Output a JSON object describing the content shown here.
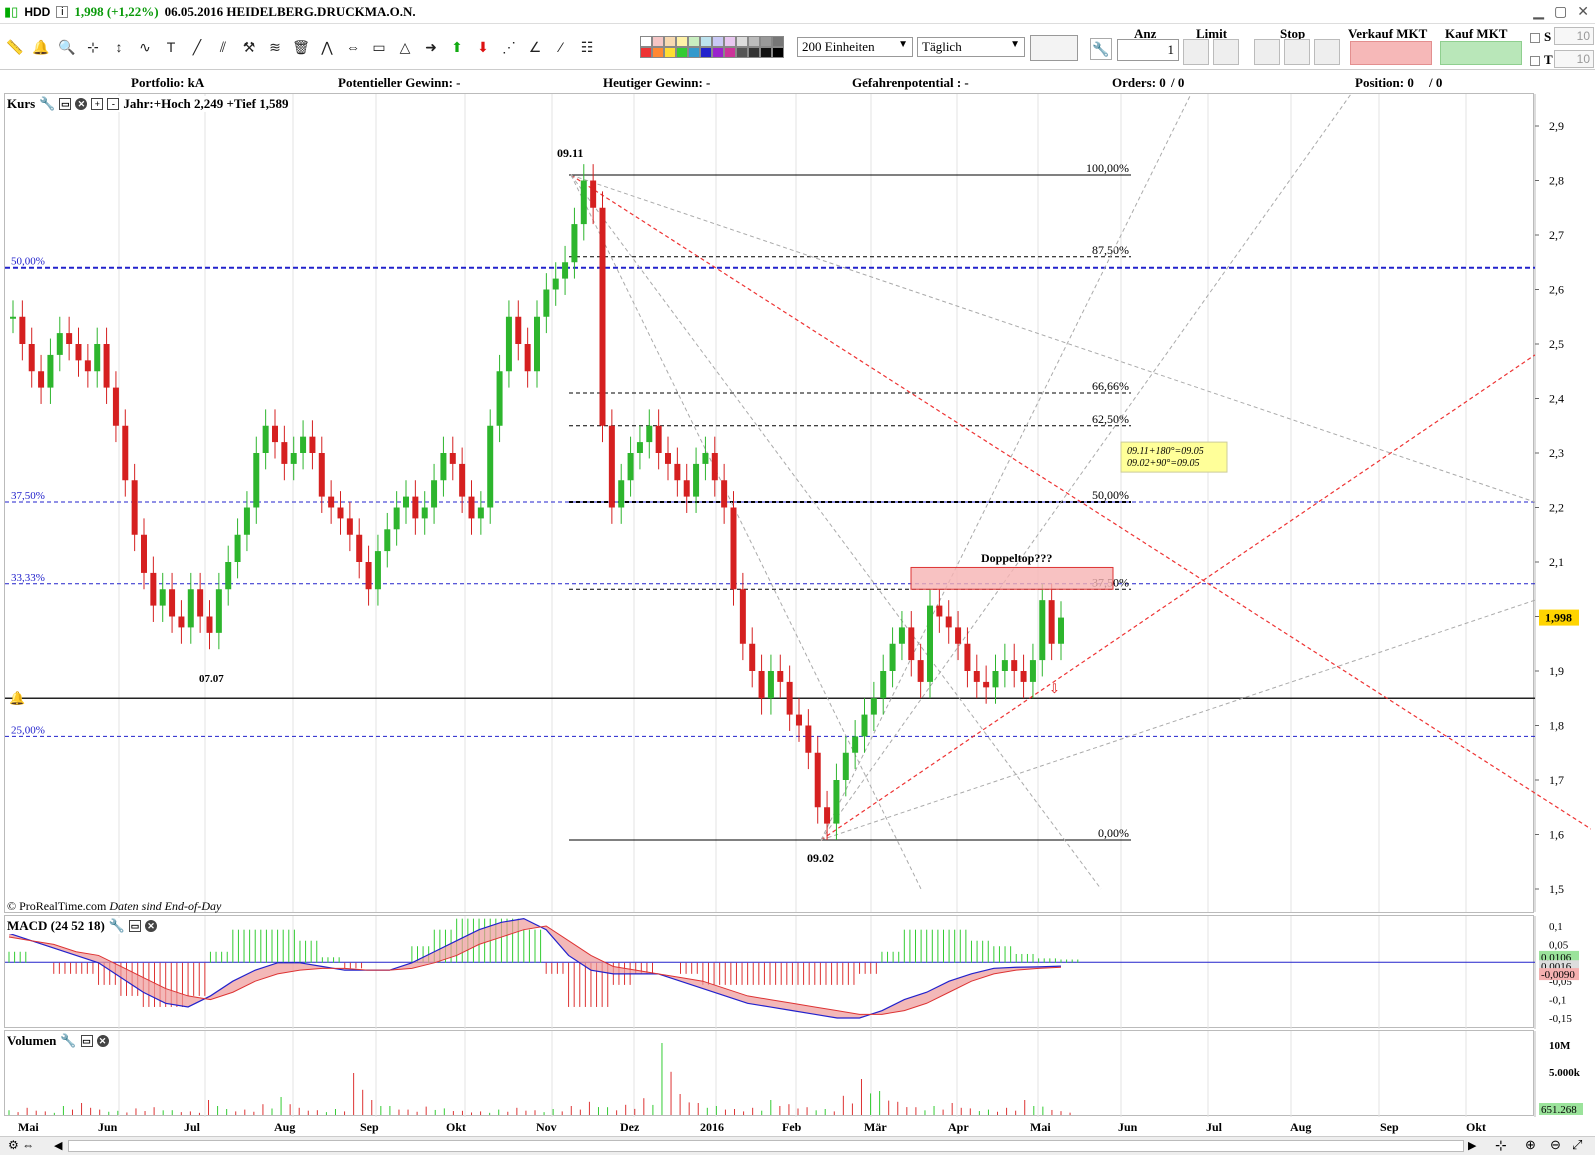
{
  "window": {
    "symbol": "HDD",
    "price_change": "1,998 (+1,22%)",
    "date_name": "06.05.2016 HEIDELBERG.DRUCKMA.O.N."
  },
  "toolbar": {
    "units_select": "200 Einheiten",
    "interval_select": "Täglich",
    "anz_label": "Anz",
    "anz_value": "1",
    "limit_label": "Limit",
    "stop_label": "Stop",
    "sell_label": "Verkauf MKT",
    "buy_label": "Kauf MKT",
    "s_label": "S",
    "s_value": "10",
    "t_label": "T",
    "t_value": "10",
    "icons": [
      "ruler-icon",
      "bell-icon",
      "zoom-icon",
      "crosshair-icon",
      "cursor-icon",
      "indicator-icon",
      "text-icon",
      "line-icon",
      "parallel-icon",
      "hammer-icon",
      "fibonacci-icon",
      "trash-icon",
      "trend-icon",
      "arrows-icon",
      "rectangle-icon",
      "triangle-icon",
      "arrow-right-icon",
      "arrow-up-icon",
      "arrow-down-icon",
      "gann-fan-icon",
      "gann-angle-icon",
      "line-tool-icon",
      "properties-icon"
    ]
  },
  "infobar": {
    "portfolio": "Portfolio: kA",
    "potential_gain": "Potentieller Gewinn: -",
    "today_gain": "Heutiger Gewinn: -",
    "risk": "Gefahrenpotential : -",
    "orders": "Orders: 0",
    "orders_sep": "/ 0",
    "position": "Position: 0",
    "position_sep": "/ 0"
  },
  "price_pane": {
    "title": "Kurs",
    "subtitle": "Jahr:+Hoch 2,249 +Tief 1,589",
    "current_price": "1,998",
    "copyright": "© ProRealTime.com",
    "eod_note": "Daten sind End-of-Day",
    "annotations": {
      "high_label": "09.11",
      "low_label": "09.02",
      "jul_label": "07.07",
      "doppeltop": "Doppeltop???",
      "note_line1": "09.11+180°=09.05",
      "note_line2": "09.02+90°=09.05"
    },
    "fib_labels": [
      "100,00%",
      "87,50%",
      "66,66%",
      "62,50%",
      "50,00%",
      "37,50%",
      "0,00%"
    ],
    "level_labels": [
      "50,00%",
      "37,50%",
      "33,33%",
      "25,00%"
    ]
  },
  "macd_pane": {
    "title": "MACD (24 52 18)",
    "value1": "0,0106",
    "value2": "0,0016",
    "value3": "-0,0090"
  },
  "volume_pane": {
    "title": "Volumen",
    "last_value": "651.268"
  },
  "chart_data": [
    {
      "type": "candlestick",
      "title": "Kurs",
      "y_ticks": [
        "2,9",
        "2,8",
        "2,7",
        "2,6",
        "2,5",
        "2,4",
        "2,3",
        "2,2",
        "2,1",
        "2",
        "1,9",
        "1,8",
        "1,7",
        "1,6",
        "1,5"
      ],
      "x_ticks": [
        "Mai",
        "Jun",
        "Jul",
        "Aug",
        "Sep",
        "Okt",
        "Nov",
        "Dez",
        "2016",
        "Feb",
        "Mär",
        "Apr",
        "Mai",
        "Jun",
        "Jul",
        "Aug",
        "Sep",
        "Okt"
      ],
      "ylim": [
        1.5,
        2.9
      ],
      "series": [
        {
          "values": [
            2.55,
            2.5,
            2.45,
            2.42,
            2.48,
            2.52,
            2.5,
            2.47,
            2.45,
            2.5,
            2.42,
            2.35,
            2.25,
            2.15,
            2.08,
            2.02,
            2.05,
            2.0,
            1.98,
            2.05,
            2.0,
            1.97,
            2.05,
            2.1,
            2.15,
            2.2,
            2.3,
            2.35,
            2.32,
            2.28,
            2.3,
            2.33,
            2.3,
            2.22,
            2.2,
            2.18,
            2.15,
            2.1,
            2.05,
            2.12,
            2.16,
            2.2,
            2.22,
            2.18,
            2.2,
            2.25,
            2.3,
            2.28,
            2.22,
            2.18,
            2.2,
            2.35,
            2.45,
            2.55,
            2.5,
            2.45,
            2.55,
            2.6,
            2.62,
            2.65,
            2.72,
            2.8,
            2.75,
            2.35,
            2.2,
            2.25,
            2.3,
            2.32,
            2.35,
            2.3,
            2.28,
            2.25,
            2.22,
            2.28,
            2.3,
            2.25,
            2.2,
            2.05,
            1.95,
            1.9,
            1.85,
            1.9,
            1.88,
            1.82,
            1.8,
            1.75,
            1.65,
            1.62,
            1.7,
            1.75,
            1.78,
            1.82,
            1.85,
            1.9,
            1.95,
            1.98,
            1.92,
            1.88,
            2.02,
            2.0,
            1.98,
            1.95,
            1.9,
            1.88,
            1.87,
            1.9,
            1.92,
            1.9,
            1.88,
            1.92,
            2.03,
            1.95,
            1.998
          ]
        }
      ],
      "fib_levels": [
        2.81,
        2.66,
        2.41,
        2.35,
        2.21,
        2.05,
        1.59
      ],
      "horizontal_levels": [
        2.64,
        2.21,
        2.06,
        1.85,
        1.78
      ]
    },
    {
      "type": "area",
      "title": "MACD (24 52 18)",
      "y_ticks": [
        "0,1",
        "0,05",
        "0",
        "-0,05",
        "-0,1",
        "-0,15"
      ],
      "ylim": [
        -0.17,
        0.12
      ],
      "series": [
        {
          "name": "MACD",
          "values": [
            0.08,
            0.06,
            0.04,
            0.02,
            0.0,
            -0.04,
            -0.08,
            -0.11,
            -0.12,
            -0.09,
            -0.05,
            -0.02,
            0.0,
            0.0,
            -0.01,
            -0.02,
            -0.02,
            -0.02,
            0.0,
            0.03,
            0.06,
            0.09,
            0.11,
            0.12,
            0.09,
            0.02,
            -0.02,
            -0.03,
            -0.03,
            -0.03,
            -0.05,
            -0.07,
            -0.09,
            -0.11,
            -0.12,
            -0.13,
            -0.14,
            -0.15,
            -0.15,
            -0.13,
            -0.1,
            -0.08,
            -0.05,
            -0.03,
            -0.015,
            -0.012,
            -0.011,
            -0.009
          ]
        },
        {
          "name": "Signal",
          "values": [
            0.07,
            0.06,
            0.05,
            0.03,
            0.02,
            -0.01,
            -0.04,
            -0.07,
            -0.09,
            -0.1,
            -0.08,
            -0.05,
            -0.03,
            -0.02,
            -0.015,
            -0.015,
            -0.02,
            -0.02,
            -0.015,
            0.0,
            0.02,
            0.05,
            0.07,
            0.09,
            0.1,
            0.06,
            0.02,
            -0.01,
            -0.02,
            -0.03,
            -0.04,
            -0.05,
            -0.07,
            -0.09,
            -0.1,
            -0.11,
            -0.12,
            -0.13,
            -0.14,
            -0.14,
            -0.13,
            -0.11,
            -0.08,
            -0.05,
            -0.03,
            -0.02,
            -0.015,
            -0.012
          ]
        }
      ]
    },
    {
      "type": "bar",
      "title": "Volumen",
      "y_ticks": [
        "10M",
        "5.000k"
      ],
      "ylim": [
        0,
        12000000
      ],
      "values": [
        0.8,
        1.2,
        0.6,
        1.5,
        2.0,
        0.9,
        0.7,
        1.1,
        1.3,
        0.8,
        0.6,
        2.5,
        1.0,
        0.9,
        1.8,
        3.0,
        1.2,
        0.8,
        1.0,
        7.0,
        2.5,
        1.5,
        0.9,
        1.4,
        1.1,
        0.7,
        0.6,
        0.9,
        1.2,
        0.8,
        1.0,
        1.5,
        2.2,
        1.3,
        1.7,
        2.8,
        12.0,
        3.5,
        2.0,
        1.5,
        1.0,
        1.2,
        2.5,
        1.8,
        1.3,
        1.0,
        3.2,
        6.0,
        4.0,
        2.2,
        1.3,
        1.5,
        2.0,
        1.1,
        0.9,
        1.2,
        2.5,
        1.4,
        0.65
      ]
    }
  ]
}
